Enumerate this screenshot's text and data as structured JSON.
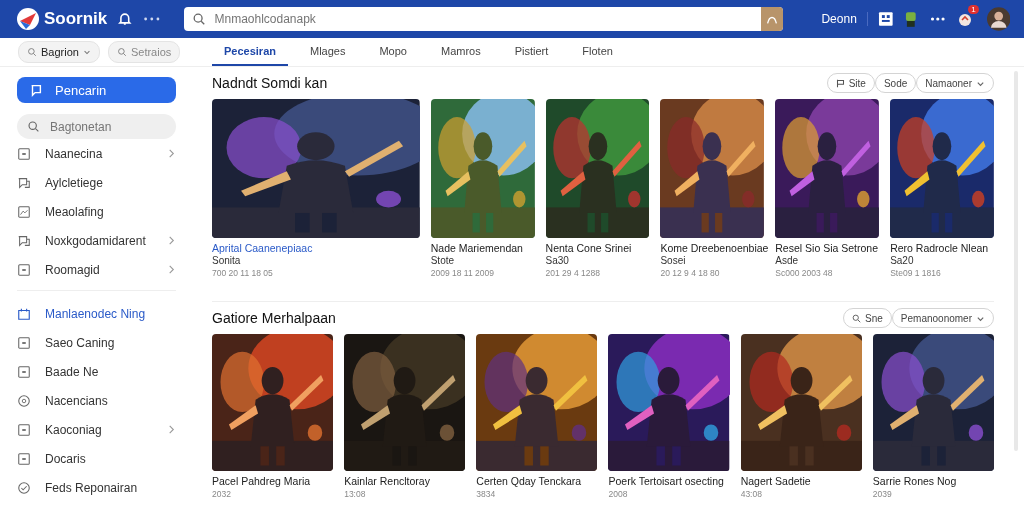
{
  "header": {
    "logo": "Soornik",
    "search": {
      "placeholder": "Mnmaohlcodanapk"
    },
    "user_label": "Deonn",
    "notification_count": "1"
  },
  "filters": [
    {
      "label": "Bagrion",
      "kind": "dropdown"
    },
    {
      "label": "Setraios",
      "kind": "search"
    }
  ],
  "tabs": [
    {
      "label": "Pecesiran",
      "selected": true
    },
    {
      "label": "Mlages",
      "selected": false
    },
    {
      "label": "Mopo",
      "selected": false
    },
    {
      "label": "Mamros",
      "selected": false
    },
    {
      "label": "Pistiert",
      "selected": false
    },
    {
      "label": "Floten",
      "selected": false
    }
  ],
  "sidebar": {
    "primary_button": "Pencarin",
    "search": {
      "placeholder": "Bagtonetan"
    },
    "groups": [
      [
        {
          "label": "Naanecina",
          "expandable": true,
          "selected": false
        },
        {
          "label": "Aylcletiege",
          "expandable": false,
          "selected": false
        },
        {
          "label": "Meaolafing",
          "expandable": false,
          "selected": false
        },
        {
          "label": "Noxkgodamidarent",
          "expandable": true,
          "selected": false
        },
        {
          "label": "Roomagid",
          "expandable": true,
          "selected": false
        }
      ],
      [
        {
          "label": "Manlaenodec Ning",
          "expandable": false,
          "selected": true
        },
        {
          "label": "Saeo Caning",
          "expandable": false,
          "selected": false
        },
        {
          "label": "Baade Ne",
          "expandable": false,
          "selected": false
        },
        {
          "label": "Nacencians",
          "expandable": false,
          "selected": false
        },
        {
          "label": "Kaoconiag",
          "expandable": true,
          "selected": false
        },
        {
          "label": "Docaris",
          "expandable": false,
          "selected": false
        },
        {
          "label": "Feds Reponairan",
          "expandable": false,
          "selected": false
        }
      ]
    ]
  },
  "sections": [
    {
      "title": "Nadndt Somdi kan",
      "controls": [
        {
          "kind": "flag",
          "label": "Site"
        },
        {
          "kind": "plain",
          "label": "Sode"
        },
        {
          "kind": "dropdown",
          "label": "Namaoner"
        }
      ],
      "cards": [
        {
          "title": "Aprital Caanenepiaac",
          "subtitle": "Sonita",
          "meta": "700 20 11 18 05",
          "highlighted": true
        },
        {
          "title": "Nade Mariemendan",
          "subtitle": "Stote",
          "meta": "2009 18 11 2009",
          "highlighted": false
        },
        {
          "title": "Nenta Cone Srinei",
          "subtitle": "Sa30",
          "meta": "201 29 4 1288",
          "highlighted": false
        },
        {
          "title": "Kome Dreebenoenbiae",
          "subtitle": "Sosei",
          "meta": "20 12 9 4 18 80",
          "highlighted": false
        },
        {
          "title": "Resel Sio Sia Setrone",
          "subtitle": "Asde",
          "meta": "Sc000 2003 48",
          "highlighted": false
        },
        {
          "title": "Rero Radrocle Nlean",
          "subtitle": "Sa20",
          "meta": "Ste09 1 1816",
          "highlighted": false
        }
      ]
    },
    {
      "title": "Gatiore Merhalpaan",
      "controls": [
        {
          "kind": "search",
          "label": "Sne"
        },
        {
          "kind": "dropdown",
          "label": "Pemanoonomer"
        }
      ],
      "cards": [
        {
          "title": "Pacel Pahdreg Maria",
          "meta": "2032",
          "highlighted": false
        },
        {
          "title": "Kainlar Rencltoray",
          "meta": "13:08",
          "highlighted": false
        },
        {
          "title": "Certen Qday Tenckara",
          "meta": "3834",
          "highlighted": false
        },
        {
          "title": "Poerk Tertoisart osecting",
          "meta": "2008",
          "highlighted": false
        },
        {
          "title": "Nagert Sadetie",
          "meta": "43:08",
          "highlighted": false
        },
        {
          "title": "Sarrie Rones Nog",
          "meta": "2039",
          "highlighted": false
        }
      ]
    }
  ]
}
